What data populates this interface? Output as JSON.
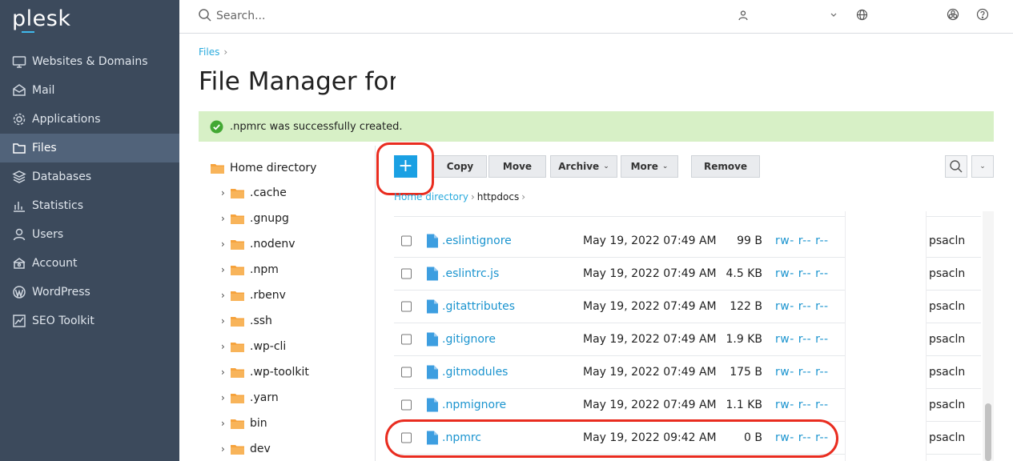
{
  "brand": {
    "logo": "plesk"
  },
  "topbar": {
    "search_placeholder": "Search..."
  },
  "sidebar": {
    "items": [
      {
        "label": "Websites & Domains",
        "icon": "monitor-icon"
      },
      {
        "label": "Mail",
        "icon": "mail-icon"
      },
      {
        "label": "Applications",
        "icon": "gear-icon"
      },
      {
        "label": "Files",
        "icon": "folder-icon",
        "active": true
      },
      {
        "label": "Databases",
        "icon": "database-icon"
      },
      {
        "label": "Statistics",
        "icon": "bar-chart-icon"
      },
      {
        "label": "Users",
        "icon": "user-icon"
      },
      {
        "label": "Account",
        "icon": "account-icon"
      },
      {
        "label": "WordPress",
        "icon": "wordpress-icon"
      },
      {
        "label": "SEO Toolkit",
        "icon": "seo-chart-icon"
      }
    ]
  },
  "breadcrumb_top": "Files",
  "page_title": "File Manager for",
  "alert": {
    "message": ".npmrc was successfully created."
  },
  "tree": {
    "root": "Home directory",
    "items": [
      ".cache",
      ".gnupg",
      ".nodenv",
      ".npm",
      ".rbenv",
      ".ssh",
      ".wp-cli",
      ".wp-toolkit",
      ".yarn",
      "bin",
      "dev"
    ]
  },
  "toolbar": {
    "add": "+",
    "copy": "Copy",
    "move": "Move",
    "archive": "Archive",
    "more": "More",
    "remove": "Remove"
  },
  "breadcrumb_inner": {
    "home": "Home directory",
    "current": "httpdocs"
  },
  "files": [
    {
      "name": ".eslintignore",
      "date": "May 19, 2022 07:49 AM",
      "size": "99 B",
      "perm": "rw- r-- r--",
      "owner": "psacln"
    },
    {
      "name": ".eslintrc.js",
      "date": "May 19, 2022 07:49 AM",
      "size": "4.5 KB",
      "perm": "rw- r-- r--",
      "owner": "psacln"
    },
    {
      "name": ".gitattributes",
      "date": "May 19, 2022 07:49 AM",
      "size": "122 B",
      "perm": "rw- r-- r--",
      "owner": "psacln"
    },
    {
      "name": ".gitignore",
      "date": "May 19, 2022 07:49 AM",
      "size": "1.9 KB",
      "perm": "rw- r-- r--",
      "owner": "psacln"
    },
    {
      "name": ".gitmodules",
      "date": "May 19, 2022 07:49 AM",
      "size": "175 B",
      "perm": "rw- r-- r--",
      "owner": "psacln"
    },
    {
      "name": ".npmignore",
      "date": "May 19, 2022 07:49 AM",
      "size": "1.1 KB",
      "perm": "rw- r-- r--",
      "owner": "psacln"
    },
    {
      "name": ".npmrc",
      "date": "May 19, 2022 09:42 AM",
      "size": "0 B",
      "perm": "rw- r-- r--",
      "owner": "psacln"
    }
  ],
  "colors": {
    "sidebar": "#3c4a5c",
    "accent": "#1aa0e3",
    "link": "#1b94cf",
    "success_bg": "#d7f0c6",
    "highlight": "#e92c1f"
  }
}
